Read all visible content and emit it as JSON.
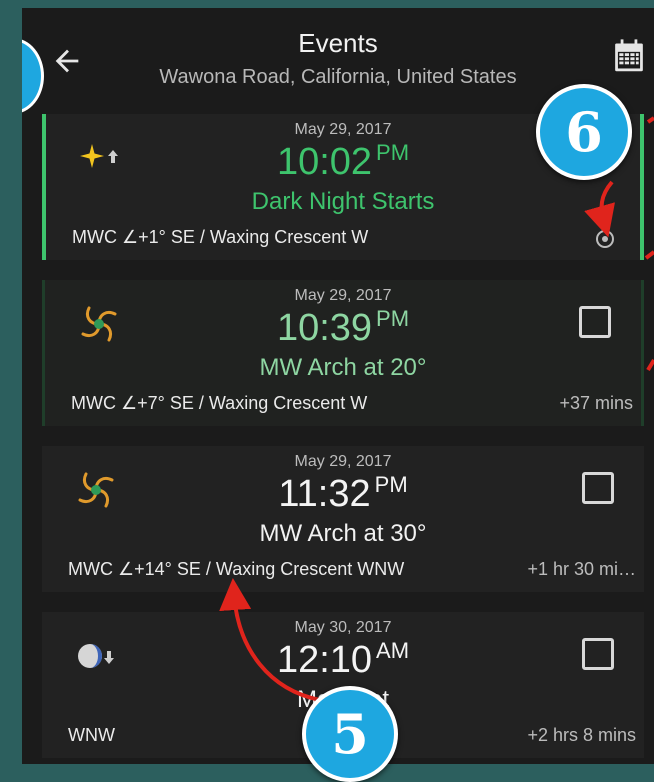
{
  "header": {
    "title": "Events",
    "location": "Wawona Road, California, United States"
  },
  "events": [
    {
      "date": "May 29, 2017",
      "time": "10:02",
      "ampm": "PM",
      "name": "Dark Night Starts",
      "detail": "MWC ∠+1° SE / Waxing Crescent W",
      "offset": "",
      "icon": "star-rise-icon"
    },
    {
      "date": "May 29, 2017",
      "time": "10:39",
      "ampm": "PM",
      "name": "MW Arch at 20°",
      "detail": "MWC ∠+7° SE / Waxing Crescent W",
      "offset": "+37 mins",
      "icon": "milky-way-icon"
    },
    {
      "date": "May 29, 2017",
      "time": "11:32",
      "ampm": "PM",
      "name": "MW Arch at 30°",
      "detail": "MWC ∠+14° SE / Waxing Crescent WNW",
      "offset": "+1 hr 30 mi…",
      "icon": "milky-way-icon"
    },
    {
      "date": "May 30, 2017",
      "time": "12:10",
      "ampm": "AM",
      "name": "Moonset",
      "detail": "WNW",
      "offset": "+2 hrs 8 mins",
      "icon": "moon-set-icon"
    }
  ],
  "annotations": {
    "badge_6": "6",
    "badge_5": "5"
  },
  "colors": {
    "accent_green": "#3ec46d",
    "light_green": "#8ed6a2",
    "badge_blue": "#1ea7e0",
    "arrow_red": "#e0241c"
  }
}
